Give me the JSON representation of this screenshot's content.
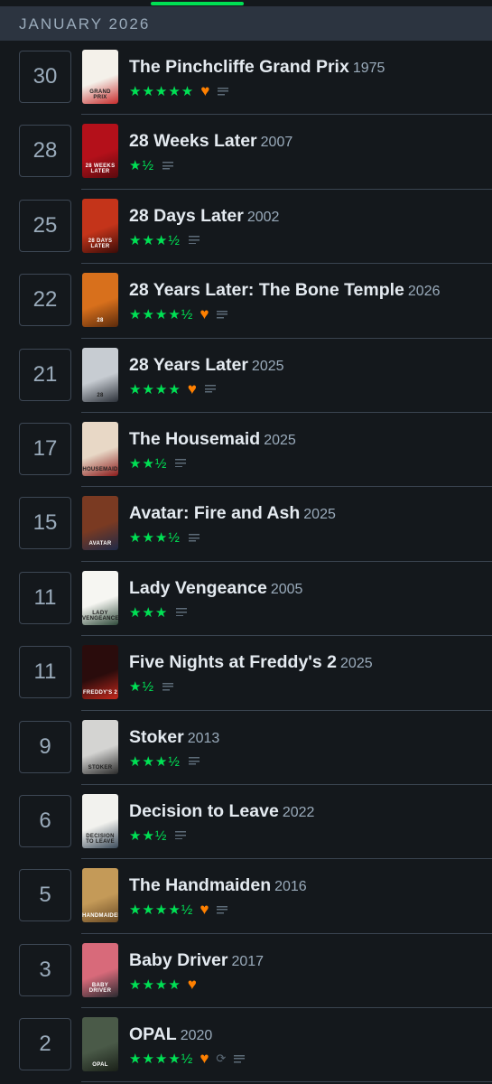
{
  "section": {
    "header": "JANUARY 2026"
  },
  "entries": [
    {
      "day": "30",
      "title": "The Pinchcliffe Grand Prix",
      "year": "1975",
      "stars": "★★★★★",
      "liked": true,
      "review": true,
      "rewatch": false,
      "poster_color": "#f4f1ea",
      "poster_accent": "#c72c2c",
      "poster_text": "GRAND PRIX"
    },
    {
      "day": "28",
      "title": "28 Weeks Later",
      "year": "2007",
      "stars": "★½",
      "liked": false,
      "review": true,
      "rewatch": false,
      "poster_color": "#b4101a",
      "poster_accent": "#5a0a0e",
      "poster_text": "28 WEEKS LATER"
    },
    {
      "day": "25",
      "title": "28 Days Later",
      "year": "2002",
      "stars": "★★★½",
      "liked": false,
      "review": true,
      "rewatch": false,
      "poster_color": "#c4341a",
      "poster_accent": "#3a0c08",
      "poster_text": "28 DAYS LATER"
    },
    {
      "day": "22",
      "title": "28 Years Later: The Bone Temple",
      "year": "2026",
      "stars": "★★★★½",
      "liked": true,
      "review": true,
      "rewatch": false,
      "poster_color": "#d8701c",
      "poster_accent": "#5a2a0c",
      "poster_text": "28"
    },
    {
      "day": "21",
      "title": "28 Years Later",
      "year": "2025",
      "stars": "★★★★",
      "liked": true,
      "review": true,
      "rewatch": false,
      "poster_color": "#c7ccd2",
      "poster_accent": "#2b3038",
      "poster_text": "28"
    },
    {
      "day": "17",
      "title": "The Housemaid",
      "year": "2025",
      "stars": "★★½",
      "liked": false,
      "review": true,
      "rewatch": false,
      "poster_color": "#e8d8c6",
      "poster_accent": "#8a1a1a",
      "poster_text": "HOUSEMAID"
    },
    {
      "day": "15",
      "title": "Avatar: Fire and Ash",
      "year": "2025",
      "stars": "★★★½",
      "liked": false,
      "review": true,
      "rewatch": false,
      "poster_color": "#7a3a22",
      "poster_accent": "#1f2a48",
      "poster_text": "AVATAR"
    },
    {
      "day": "11",
      "title": "Lady Vengeance",
      "year": "2005",
      "stars": "★★★",
      "liked": false,
      "review": true,
      "rewatch": false,
      "poster_color": "#f6f6f2",
      "poster_accent": "#2f4a3a",
      "poster_text": "LADY VENGEANCE"
    },
    {
      "day": "11",
      "title": "Five Nights at Freddy's 2",
      "year": "2025",
      "stars": "★½",
      "liked": false,
      "review": true,
      "rewatch": false,
      "poster_color": "#2a0c0c",
      "poster_accent": "#c4281c",
      "poster_text": "FREDDY'S 2"
    },
    {
      "day": "9",
      "title": "Stoker",
      "year": "2013",
      "stars": "★★★½",
      "liked": false,
      "review": true,
      "rewatch": false,
      "poster_color": "#d4d4d2",
      "poster_accent": "#2a2a2a",
      "poster_text": "STOKER"
    },
    {
      "day": "6",
      "title": "Decision to Leave",
      "year": "2022",
      "stars": "★★½",
      "liked": false,
      "review": true,
      "rewatch": false,
      "poster_color": "#f2f2ee",
      "poster_accent": "#3a4a5a",
      "poster_text": "DECISION TO LEAVE"
    },
    {
      "day": "5",
      "title": "The Handmaiden",
      "year": "2016",
      "stars": "★★★★½",
      "liked": true,
      "review": true,
      "rewatch": false,
      "poster_color": "#c49a58",
      "poster_accent": "#6a4a24",
      "poster_text": "HANDMAIDEN"
    },
    {
      "day": "3",
      "title": "Baby Driver",
      "year": "2017",
      "stars": "★★★★",
      "liked": true,
      "review": false,
      "rewatch": false,
      "poster_color": "#d86a7a",
      "poster_accent": "#2a2a30",
      "poster_text": "BABY DRIVER"
    },
    {
      "day": "2",
      "title": "OPAL",
      "year": "2020",
      "stars": "★★★★½",
      "liked": true,
      "review": true,
      "rewatch": true,
      "poster_color": "#4a5a48",
      "poster_accent": "#1a2018",
      "poster_text": "OPAL"
    }
  ],
  "colors": {
    "star": "#00e054",
    "like": "#ff8000",
    "accent": "#00e054",
    "background": "#14181c",
    "header": "#2c3440"
  },
  "icons": {
    "like": "heart-icon",
    "review": "review-lines-icon",
    "rewatch": "rewatch-icon"
  }
}
